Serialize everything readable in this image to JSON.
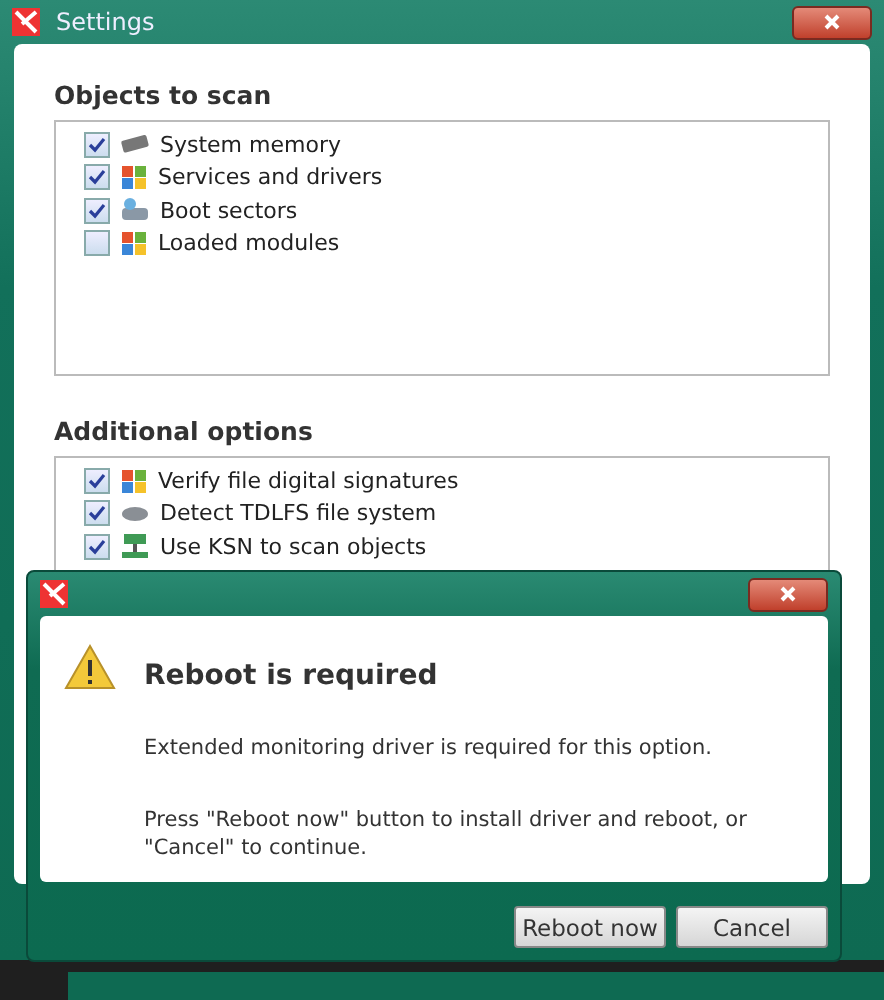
{
  "window": {
    "title": "Settings"
  },
  "sections": [
    {
      "title": "Objects to scan",
      "items": [
        {
          "label": "System memory",
          "checked": true,
          "kind": "chip"
        },
        {
          "label": "Services and drivers",
          "checked": true,
          "kind": "flag"
        },
        {
          "label": "Boot sectors",
          "checked": true,
          "kind": "drive"
        },
        {
          "label": "Loaded modules",
          "checked": false,
          "kind": "flag"
        }
      ]
    },
    {
      "title": "Additional options",
      "items": [
        {
          "label": "Verify file digital signatures",
          "checked": true,
          "kind": "flag"
        },
        {
          "label": "Detect TDLFS file system",
          "checked": true,
          "kind": "disk"
        },
        {
          "label": "Use KSN to scan objects",
          "checked": true,
          "kind": "network"
        }
      ]
    }
  ],
  "dialog": {
    "heading": "Reboot is required",
    "messages": [
      "Extended monitoring driver is required for this option.",
      "Press \"Reboot now\" button to install driver and reboot, or \"Cancel\" to continue."
    ],
    "buttons": [
      "Reboot now",
      "Cancel"
    ]
  }
}
